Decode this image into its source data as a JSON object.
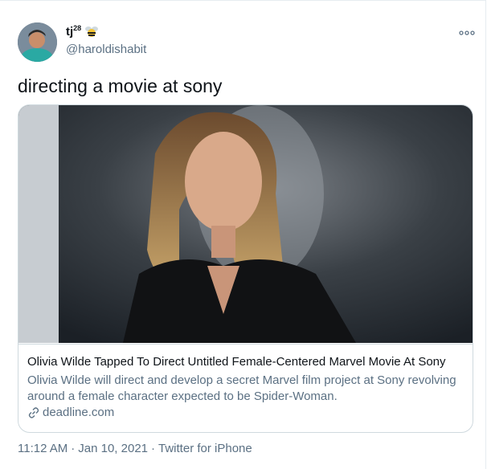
{
  "author": {
    "name": "tj",
    "superscript": "28",
    "handle": "@haroldishabit",
    "badge_icon": "bee-icon",
    "avatar_icon": "avatar-icon"
  },
  "tweet": {
    "text": "directing a movie at sony"
  },
  "card": {
    "title": "Olivia Wilde Tapped To Direct Untitled Female-Centered Marvel Movie At Sony",
    "description": "Olivia Wilde will direct and develop a secret Marvel film project at Sony revolving around a female character expected to be Spider-Woman.",
    "domain": "deadline.com",
    "link_icon": "link-icon"
  },
  "meta": {
    "time": "11:12 AM",
    "separator": "·",
    "date": "Jan 10, 2021",
    "source": "Twitter for iPhone"
  },
  "colors": {
    "text": "#0f1419",
    "secondary": "#5b7083",
    "border": "#cfd9de"
  }
}
